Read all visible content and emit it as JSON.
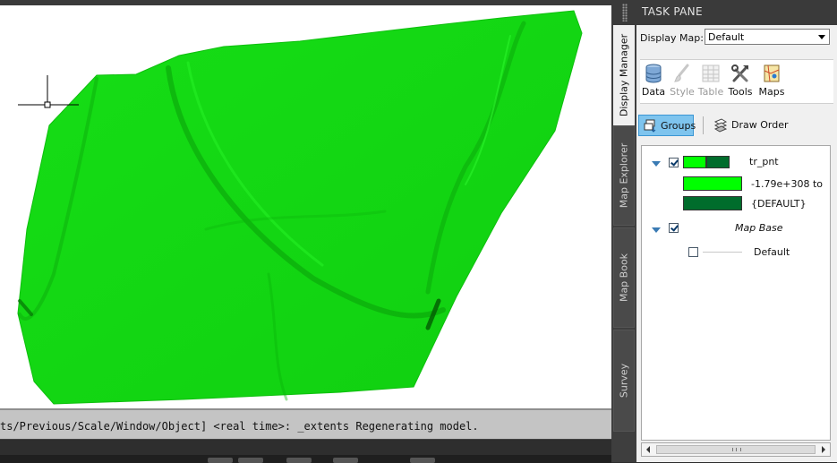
{
  "window": {
    "bg_color": "#2b2b2b"
  },
  "canvas": {
    "bg_color": "#ffffff",
    "surface_color": "#12d712",
    "crosshair_color": "#000000"
  },
  "command_line": {
    "text": "ts/Previous/Scale/Window/Object] <real time>: _extents Regenerating model."
  },
  "task_pane": {
    "title": "TASK PANE",
    "tabs": [
      {
        "label": "Display Manager",
        "active": true
      },
      {
        "label": "Map Explorer",
        "active": false
      },
      {
        "label": "Map Book",
        "active": false
      },
      {
        "label": "Survey",
        "active": false
      }
    ],
    "display_map": {
      "label": "Display Map:",
      "value": "Default"
    },
    "toolbar": [
      {
        "label": "Data",
        "icon": "database-icon",
        "enabled": true
      },
      {
        "label": "Style",
        "icon": "brush-icon",
        "enabled": false
      },
      {
        "label": "Table",
        "icon": "table-icon",
        "enabled": false
      },
      {
        "label": "Tools",
        "icon": "tools-icon",
        "enabled": true
      },
      {
        "label": "Maps",
        "icon": "maps-icon",
        "enabled": true
      }
    ],
    "view_buttons": {
      "groups": {
        "label": "Groups",
        "icon": "groups-icon",
        "active": true
      },
      "draw_order": {
        "label": "Draw Order",
        "icon": "draw-order-icon",
        "active": false
      }
    },
    "layers": {
      "tr_pnt": {
        "name": "tr_pnt",
        "checked": true,
        "colors": [
          "#00ff00",
          "#006d2c"
        ],
        "legend": [
          {
            "label": "-1.79e+308 to",
            "color": "#00ff00"
          },
          {
            "label": "{DEFAULT}",
            "color": "#006d2c"
          }
        ]
      },
      "map_base": {
        "name": "Map Base",
        "checked": true,
        "child": {
          "name": "Default",
          "checked": false
        }
      }
    }
  }
}
